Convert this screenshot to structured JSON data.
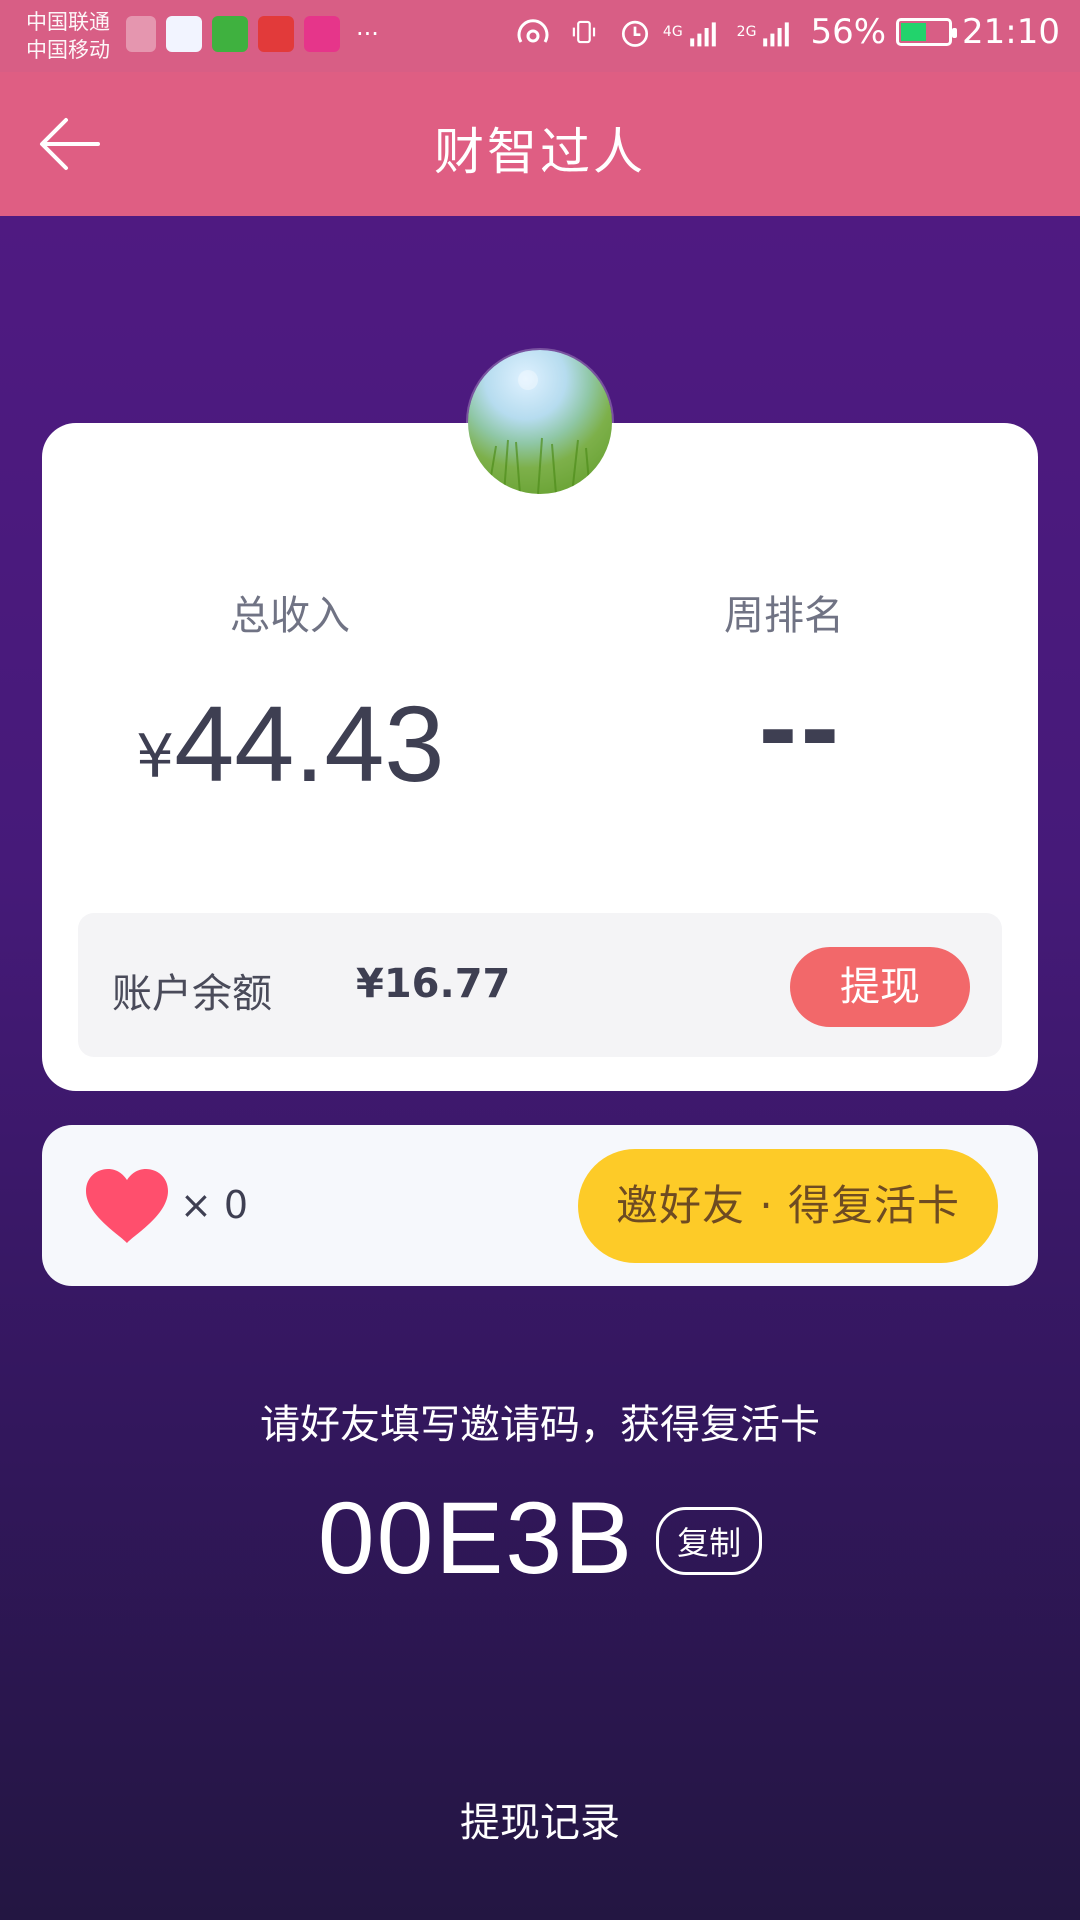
{
  "status_bar": {
    "carrier_1": "中国联通",
    "carrier_2": "中国移动",
    "more": "···",
    "net_1": "4G",
    "net_2": "2G",
    "battery": "56%",
    "battery_level": 0.56,
    "time": "21:10"
  },
  "app_bar": {
    "title": "财智过人"
  },
  "stats": {
    "total_income_label": "总收入",
    "currency_symbol": "¥",
    "total_income_value": "44.43",
    "weekly_rank_label": "周排名",
    "weekly_rank_value": "--"
  },
  "balance": {
    "label": "账户余额",
    "amount": "¥16.77",
    "withdraw_button": "提现"
  },
  "lives": {
    "count": "× 0",
    "invite_button": "邀好友 · 得复活卡"
  },
  "invite": {
    "hint": "请好友填写邀请码，获得复活卡",
    "code": "00E3B",
    "copy_button": "复制"
  },
  "footer": {
    "withdraw_record": "提现记录"
  },
  "colors": {
    "header": "#df5e83",
    "withdraw": "#f2686a",
    "invite_button": "#fdcb28",
    "heart": "#ff4f6d"
  }
}
